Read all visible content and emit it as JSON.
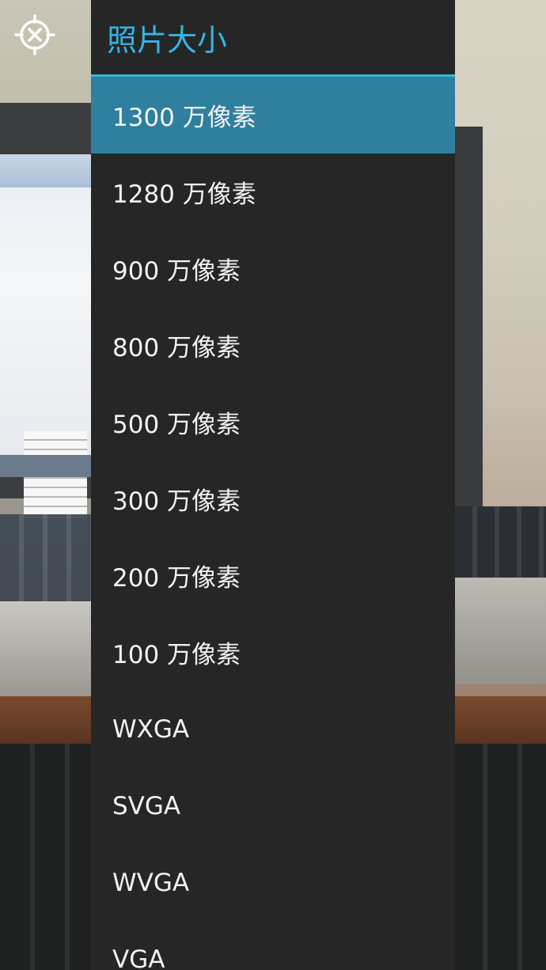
{
  "dialog": {
    "title": "照片大小",
    "accent_color": "#34b5e5",
    "selected_color": "#2f7f9e",
    "selected_index": 0,
    "options": [
      {
        "label": "1300 万像素"
      },
      {
        "label": "1280 万像素"
      },
      {
        "label": "900 万像素"
      },
      {
        "label": "800 万像素"
      },
      {
        "label": "500 万像素"
      },
      {
        "label": "300 万像素"
      },
      {
        "label": "200 万像素"
      },
      {
        "label": "100 万像素"
      },
      {
        "label": "WXGA"
      },
      {
        "label": "SVGA"
      },
      {
        "label": "WVGA"
      },
      {
        "label": "VGA"
      }
    ]
  },
  "camera": {
    "overlay_icon": "close-target-icon"
  }
}
